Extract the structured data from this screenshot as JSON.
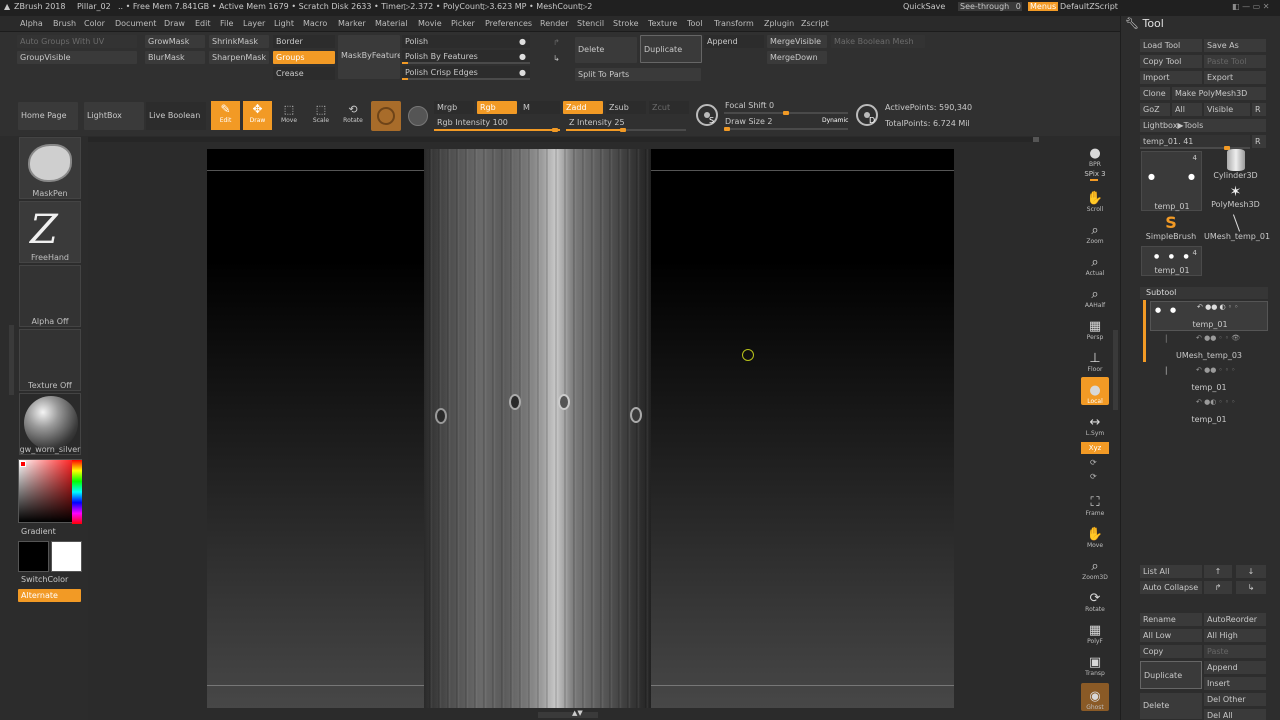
{
  "titlebar": {
    "app": "ZBrush 2018",
    "doc": "Pillar_02",
    "stats": ".. • Free Mem 7.841GB • Active Mem 1679 • Scratch Disk 2633 • Timer▷2.372 • PolyCount▷3.623 MP • MeshCount▷2",
    "quicksave": "QuickSave",
    "see_through": "See-through",
    "see_through_value": "0",
    "menus": "Menus",
    "script": "DefaultZScript"
  },
  "menubar": [
    "Alpha",
    "Brush",
    "Color",
    "Document",
    "Draw",
    "Edit",
    "File",
    "Layer",
    "Light",
    "Macro",
    "Marker",
    "Material",
    "Movie",
    "Picker",
    "Preferences",
    "Render",
    "Stencil",
    "Stroke",
    "Texture",
    "Tool",
    "Transform",
    "Zplugin",
    "Zscript"
  ],
  "topshelf": {
    "auto_groups_uv": "Auto Groups With UV",
    "group_visible": "GroupVisible",
    "grow_mask": "GrowMask",
    "shrink_mask": "ShrinkMask",
    "blur_mask": "BlurMask",
    "sharpen_mask": "SharpenMask",
    "border": "Border",
    "groups": "Groups",
    "crease": "Crease",
    "mask_by_feature": "MaskByFeature",
    "polish": "Polish",
    "polish_by_features": "Polish By Features",
    "polish_crisp_edges": "Polish Crisp Edges",
    "delete": "Delete",
    "duplicate": "Duplicate",
    "split_to_parts": "Split To Parts",
    "append": "Append",
    "merge_visible": "MergeVisible",
    "merge_down": "MergeDown",
    "make_boolean_mesh": "Make Boolean Mesh"
  },
  "toolbar2": {
    "home_page": "Home Page",
    "lightbox": "LightBox",
    "live_boolean": "Live Boolean",
    "edit": "Edit",
    "draw": "Draw",
    "move": "Move",
    "scale": "Scale",
    "rotate": "Rotate",
    "mrgb": "Mrgb",
    "rgb": "Rgb",
    "m": "M",
    "zadd": "Zadd",
    "zsub": "Zsub",
    "zcut": "Zcut",
    "rgb_intensity_label": "Rgb Intensity",
    "rgb_intensity": "100",
    "z_intensity_label": "Z Intensity",
    "z_intensity": "25",
    "focal_shift_label": "Focal Shift",
    "focal_shift": "0",
    "draw_size_label": "Draw Size",
    "draw_size": "2",
    "dynamic": "Dynamic",
    "active_points_label": "ActivePoints:",
    "active_points": "590,340",
    "total_points_label": "TotalPoints:",
    "total_points": "6.724 Mil"
  },
  "leftshelf": {
    "brush": "MaskPen",
    "stroke": "FreeHand",
    "alpha": "Alpha Off",
    "texture": "Texture Off",
    "material": "gw_worn_silver",
    "gradient": "Gradient",
    "switch_color": "SwitchColor",
    "alternate": "Alternate"
  },
  "rightshelf": [
    {
      "label": "BPR",
      "icon": "●"
    },
    {
      "label": "SPix 3",
      "icon": ""
    },
    {
      "label": "Scroll",
      "icon": "✋"
    },
    {
      "label": "Zoom",
      "icon": "⌕"
    },
    {
      "label": "Actual",
      "icon": "⌕"
    },
    {
      "label": "AAHalf",
      "icon": "⌕"
    },
    {
      "label": "Persp",
      "icon": "▦"
    },
    {
      "label": "Floor",
      "icon": "⊥"
    },
    {
      "label": "Local",
      "icon": "●"
    },
    {
      "label": "L.Sym",
      "icon": "↔"
    },
    {
      "label": "Xyz",
      "icon": ""
    },
    {
      "label": "Frame",
      "icon": "⛶"
    },
    {
      "label": "Move",
      "icon": "✋"
    },
    {
      "label": "Zoom3D",
      "icon": "⌕"
    },
    {
      "label": "Rotate",
      "icon": "⟳"
    },
    {
      "label": "PolyF",
      "icon": "▦"
    },
    {
      "label": "Transp",
      "icon": "▣"
    },
    {
      "label": "Ghost",
      "icon": "◉"
    }
  ],
  "tool_panel": {
    "title": "Tool",
    "load_tool": "Load Tool",
    "save_as": "Save As",
    "copy_tool": "Copy Tool",
    "paste_tool": "Paste Tool",
    "import": "Import",
    "export": "Export",
    "clone": "Clone",
    "make_polymesh": "Make PolyMesh3D",
    "goz": "GoZ",
    "all": "All",
    "visible": "Visible",
    "r": "R",
    "lightbox_tools": "Lightbox▶Tools",
    "current_tool": "temp_01. 41",
    "tools": [
      {
        "name": "temp_01",
        "count": "4"
      },
      {
        "name": "Cylinder3D",
        "count": ""
      },
      {
        "name": "PolyMesh3D",
        "count": ""
      },
      {
        "name": "SimpleBrush",
        "count": ""
      },
      {
        "name": "UMesh_temp_01",
        "count": ""
      },
      {
        "name": "temp_01",
        "count": "4"
      }
    ],
    "subtool_title": "Subtool",
    "subtools": [
      "temp_01",
      "UMesh_temp_03",
      "temp_01",
      "temp_01"
    ],
    "list_all": "List All",
    "auto_collapse": "Auto Collapse",
    "rename": "Rename",
    "auto_reorder": "AutoReorder",
    "all_low": "All Low",
    "all_high": "All High",
    "copy": "Copy",
    "paste": "Paste",
    "duplicate": "Duplicate",
    "append": "Append",
    "insert": "Insert",
    "delete": "Delete",
    "del_other": "Del Other",
    "del_all": "Del All"
  },
  "colors": {
    "accent": "#f29a25",
    "background": "#2b2b2b"
  }
}
